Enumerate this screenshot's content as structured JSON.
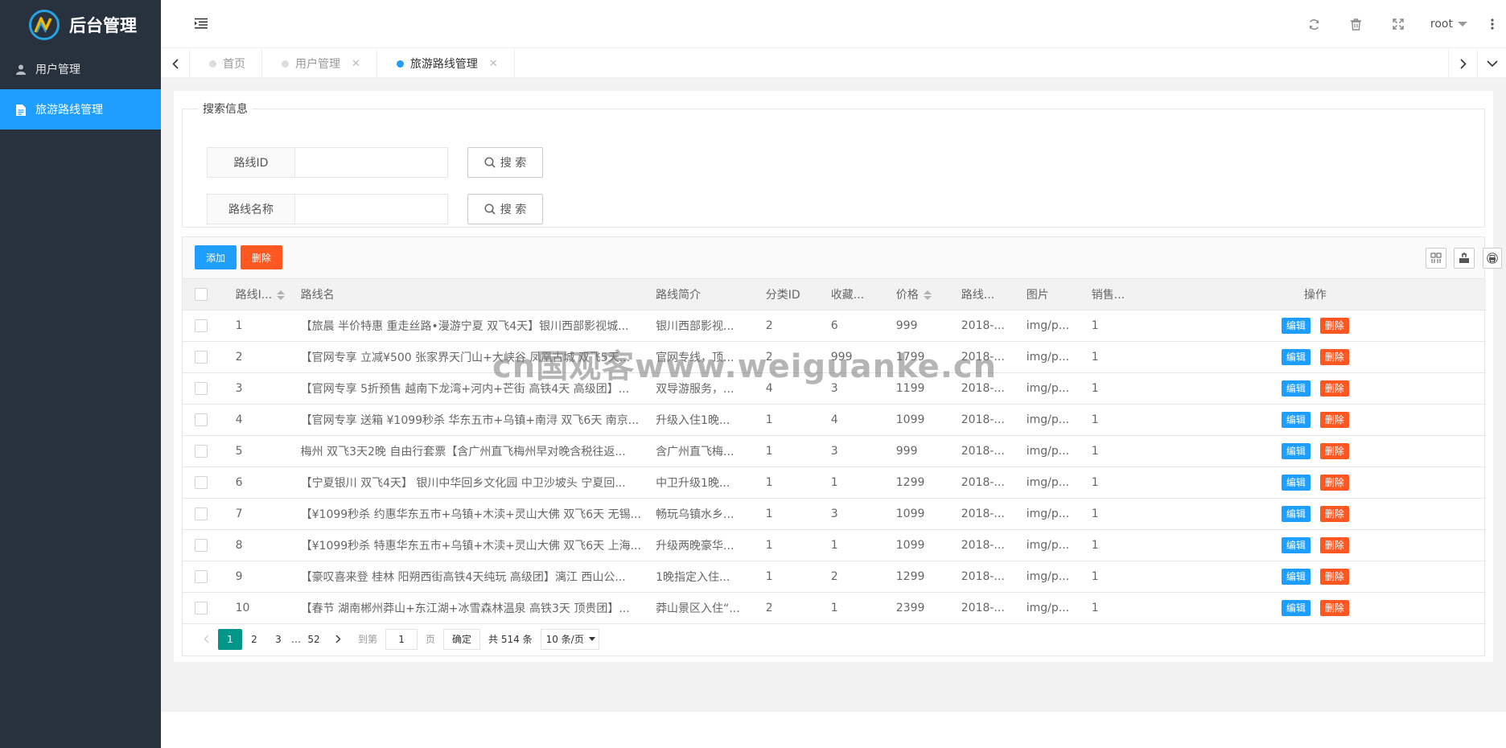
{
  "app": {
    "title": "后台管理"
  },
  "sidebar": {
    "items": [
      {
        "label": "用户管理",
        "icon": "user-icon",
        "active": false
      },
      {
        "label": "旅游路线管理",
        "icon": "file-icon",
        "active": true
      }
    ]
  },
  "header": {
    "user": "root",
    "icons": [
      "refresh-icon",
      "trash-icon",
      "fullscreen-icon",
      "more-icon"
    ]
  },
  "tabs": [
    {
      "label": "首页",
      "closable": false,
      "active": false
    },
    {
      "label": "用户管理",
      "closable": true,
      "active": false
    },
    {
      "label": "旅游路线管理",
      "closable": true,
      "active": true
    }
  ],
  "search": {
    "legend": "搜索信息",
    "fields": [
      {
        "label": "路线ID",
        "button": "搜 索"
      },
      {
        "label": "路线名称",
        "button": "搜 索"
      }
    ]
  },
  "toolbar": {
    "add_label": "添加",
    "delete_label": "删除"
  },
  "table": {
    "columns": [
      "路线I...",
      "路线名",
      "路线简介",
      "分类ID",
      "收藏...",
      "价格",
      "路线...",
      "图片",
      "销售...",
      "操作"
    ],
    "row_edit_label": "编辑",
    "row_delete_label": "删除",
    "rows": [
      [
        "1",
        "【旅晨 半价特惠 重走丝路•漫游宁夏 双飞4天】银川西部影视城...",
        "银川西部影视...",
        "2",
        "6",
        "999",
        "2018-...",
        "img/p...",
        "1"
      ],
      [
        "2",
        "【官网专享 立减¥500 张家界天门山+大峡谷 凤凰古城 双飞5天...",
        "官网专线，顶...",
        "2",
        "999",
        "1799",
        "2018-...",
        "img/p...",
        "1"
      ],
      [
        "3",
        "【官网专享 5折预售 越南下龙湾+河内+芒街 高铁4天 高级团】...",
        "双导游服务，...",
        "4",
        "3",
        "1199",
        "2018-...",
        "img/p...",
        "1"
      ],
      [
        "4",
        "【官网专享 送箱 ¥1099秒杀 华东五市+乌镇+南浔 双飞6天 南京...",
        "升级入住1晚...",
        "1",
        "4",
        "1099",
        "2018-...",
        "img/p...",
        "1"
      ],
      [
        "5",
        "梅州 双飞3天2晚 自由行套票【含广州直飞梅州早对晚含税往返...",
        "含广州直飞梅...",
        "1",
        "3",
        "999",
        "2018-...",
        "img/p...",
        "1"
      ],
      [
        "6",
        "【宁夏银川 双飞4天】 银川中华回乡文化园 中卫沙坡头 宁夏回...",
        "中卫升级1晚...",
        "1",
        "1",
        "1299",
        "2018-...",
        "img/p...",
        "1"
      ],
      [
        "7",
        "【¥1099秒杀 约惠华东五市+乌镇+木渎+灵山大佛 双飞6天 无锡...",
        "畅玩乌镇水乡...",
        "1",
        "3",
        "1099",
        "2018-...",
        "img/p...",
        "1"
      ],
      [
        "8",
        "【¥1099秒杀 特惠华东五市+乌镇+木渎+灵山大佛 双飞6天 上海...",
        "升级两晚豪华...",
        "1",
        "1",
        "1099",
        "2018-...",
        "img/p...",
        "1"
      ],
      [
        "9",
        "【豪叹喜来登 桂林 阳朔西街高铁4天纯玩 高级团】漓江 西山公...",
        "1晚指定入住...",
        "1",
        "2",
        "1299",
        "2018-...",
        "img/p...",
        "1"
      ],
      [
        "10",
        "【春节 湖南郴州莽山+东江湖+冰雪森林温泉 高铁3天 顶贵团】...",
        "莽山景区入住“...",
        "2",
        "1",
        "2399",
        "2018-...",
        "img/p...",
        "1"
      ]
    ]
  },
  "pagination": {
    "pages": [
      "1",
      "2",
      "3",
      "…",
      "52"
    ],
    "current": "1",
    "goto_prefix": "到第",
    "goto_value": "1",
    "goto_suffix": "页",
    "confirm": "确定",
    "total": "共 514 条",
    "limit": "10 条/页"
  },
  "watermark": "cn国观客www.weiguanke.cn",
  "colors": {
    "sidebar_bg": "#28323e",
    "accent": "#1e9fff",
    "danger": "#ff5722",
    "page_current": "#009688"
  }
}
